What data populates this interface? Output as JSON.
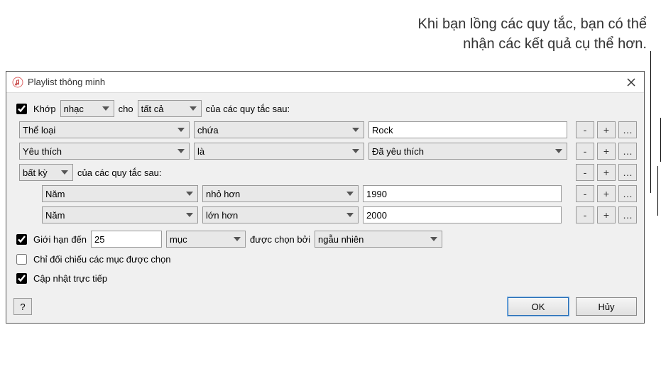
{
  "annotation": {
    "line1": "Khi bạn lồng các quy tắc, bạn có thể",
    "line2": "nhận các kết quả cụ thể hơn."
  },
  "window": {
    "title": "Playlist thông minh",
    "close_icon_name": "close-icon"
  },
  "match": {
    "checkbox_checked": true,
    "label_prefix": "Khớp",
    "media_type": "nhạc",
    "for_label": "cho",
    "quantifier": "tất cả",
    "suffix": "của các quy tắc sau:"
  },
  "rules": [
    {
      "field": "Thể loại",
      "operator": "chứa",
      "value": "Rock",
      "value_is_select": false
    },
    {
      "field": "Yêu thích",
      "operator": "là",
      "value": "Đã yêu thích",
      "value_is_select": true
    }
  ],
  "nested": {
    "quantifier": "bất kỳ",
    "suffix": "của các quy tắc sau:",
    "rules": [
      {
        "field": "Năm",
        "operator": "nhỏ hơn",
        "value": "1990"
      },
      {
        "field": "Năm",
        "operator": "lớn hơn",
        "value": "2000"
      }
    ]
  },
  "limit": {
    "checked": true,
    "label": "Giới hạn đến",
    "value": "25",
    "unit": "mục",
    "selected_by_label": "được chọn bởi",
    "selected_by_value": "ngẫu nhiên"
  },
  "match_checked": {
    "checked": false,
    "label": "Chỉ đối chiếu các mục được chọn"
  },
  "live_update": {
    "checked": true,
    "label": "Cập nhật trực tiếp"
  },
  "buttons": {
    "help": "?",
    "ok": "OK",
    "cancel": "Hủy",
    "minus": "-",
    "plus": "+",
    "more": "…"
  }
}
